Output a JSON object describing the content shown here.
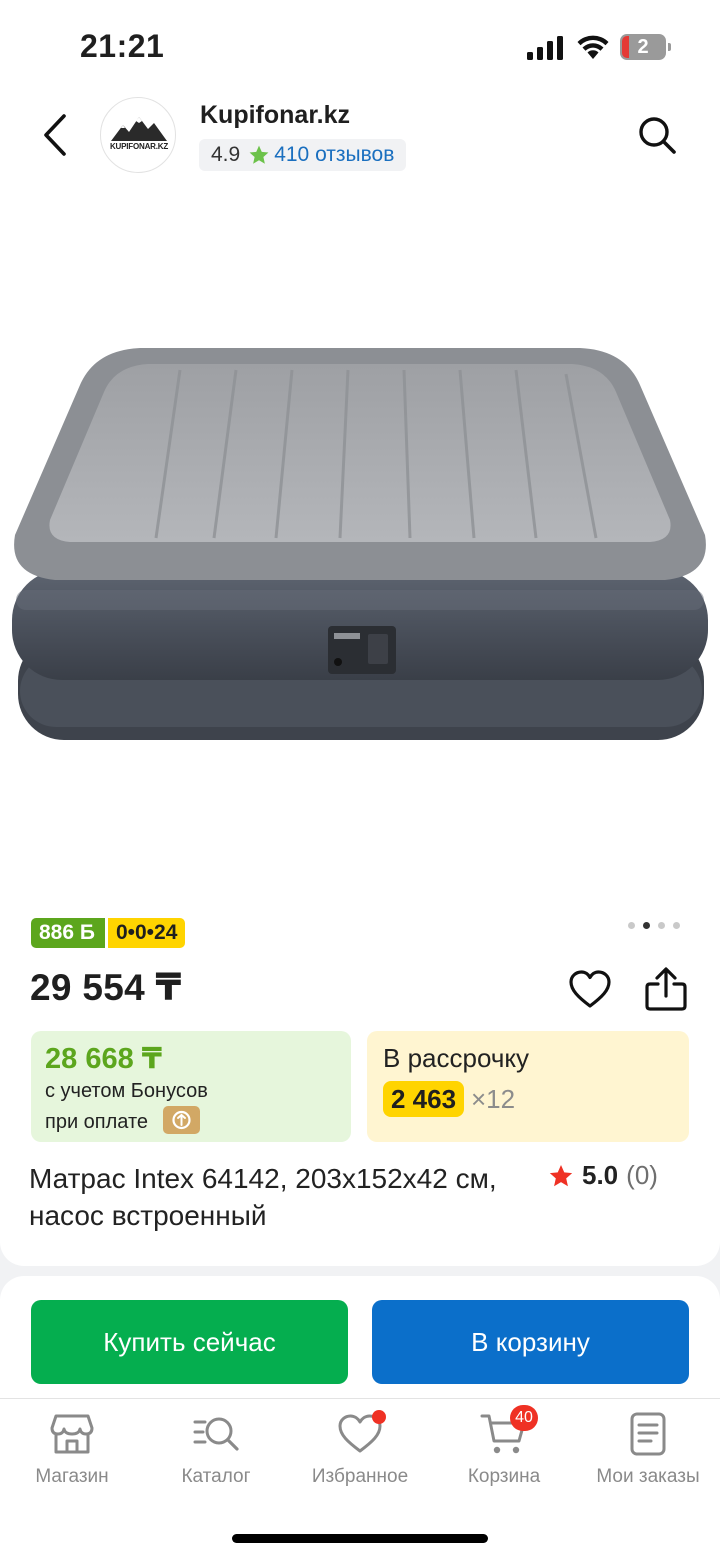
{
  "status_bar": {
    "time": "21:21",
    "battery": "2"
  },
  "header": {
    "shop_name": "Kupifonar.kz",
    "logo_text": "KUPIFONAR.KZ",
    "rating": "4.9",
    "reviews": "410 отзывов"
  },
  "product": {
    "bonus_badge": "886 Б",
    "installment_badge": "0•0•24",
    "image_count": 4,
    "active_image": 2,
    "price": "29 554 ₸",
    "bonus_price": "28 668 ₸",
    "bonus_line1": "с учетом Бонусов",
    "bonus_line2": "при оплате",
    "installment_title": "В рассрочку",
    "installment_amount": "2 463",
    "installment_months": "×12",
    "title": "Матрас Intex 64142, 203x152x42 см, насос встроенный",
    "rating_value": "5.0",
    "rating_count": "(0)"
  },
  "actions": {
    "buy_now": "Купить сейчас",
    "add_to_cart": "В корзину"
  },
  "tabbar": {
    "shop": "Магазин",
    "catalog": "Каталог",
    "favorites": "Избранное",
    "cart": "Корзина",
    "cart_count": "40",
    "orders": "Мои заказы"
  },
  "colors": {
    "bonus_green": "#5ca61d",
    "installment_yellow": "#ffd400",
    "buy_green": "#05ae4f",
    "cart_blue": "#0b6fca",
    "badge_red": "#ef3124"
  }
}
